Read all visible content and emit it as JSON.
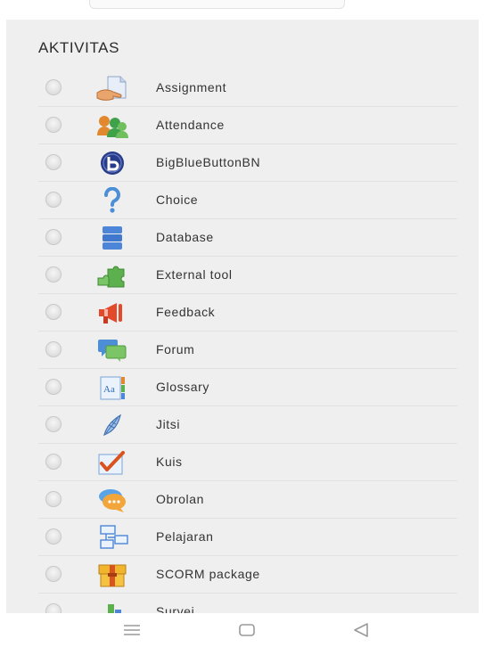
{
  "section": {
    "title": "AKTIVITAS"
  },
  "items": [
    {
      "label": "Assignment",
      "icon": "assignment-icon"
    },
    {
      "label": "Attendance",
      "icon": "attendance-icon"
    },
    {
      "label": "BigBlueButtonBN",
      "icon": "bigbluebutton-icon"
    },
    {
      "label": "Choice",
      "icon": "choice-icon"
    },
    {
      "label": "Database",
      "icon": "database-icon"
    },
    {
      "label": "External tool",
      "icon": "external-tool-icon"
    },
    {
      "label": "Feedback",
      "icon": "feedback-icon"
    },
    {
      "label": "Forum",
      "icon": "forum-icon"
    },
    {
      "label": "Glossary",
      "icon": "glossary-icon"
    },
    {
      "label": "Jitsi",
      "icon": "jitsi-icon"
    },
    {
      "label": "Kuis",
      "icon": "quiz-icon"
    },
    {
      "label": "Obrolan",
      "icon": "chat-icon"
    },
    {
      "label": "Pelajaran",
      "icon": "lesson-icon"
    },
    {
      "label": "SCORM package",
      "icon": "scorm-icon"
    },
    {
      "label": "Survei",
      "icon": "survey-icon"
    }
  ],
  "nav": {
    "menu": "menu-icon",
    "home": "home-icon",
    "back": "back-icon"
  }
}
